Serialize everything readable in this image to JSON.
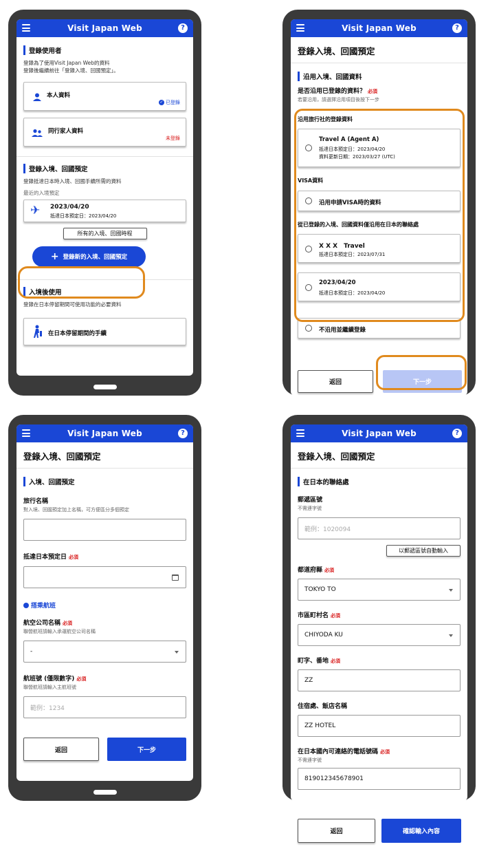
{
  "app": {
    "title": "Visit Japan Web",
    "help": "?"
  },
  "p1": {
    "sec1_title": "登錄使用者",
    "sec1_desc1": "登錄為了使用Visit Japan Web的資料",
    "sec1_desc2": "登錄後繼續前往「登錄入境、回國預定」。",
    "card_self": "本人資料",
    "card_self_status": "已登錄",
    "card_family": "同行家人資料",
    "card_family_status": "未登錄",
    "sec2_title": "登錄入境、回國預定",
    "sec2_desc": "登錄抵達日本時入境、回國手續所需的資料",
    "recent_label": "最近的入境預定",
    "trip_date": "2023/04/20",
    "trip_sub": "抵達日本預定日：2023/04/20",
    "all_trips": "所有的入境、回國時程",
    "new_trip_btn": "登錄新的入境、回國預定",
    "sec3_title": "入境後使用",
    "sec3_desc": "登錄在日本停留期間可使用功能的必要資料",
    "stay_card": "在日本停留期間的手續"
  },
  "p2": {
    "page_title": "登錄入境、回國預定",
    "sec_title": "沿用入境、回國資料",
    "question": "是否沿用已登錄的資料？",
    "required": "必須",
    "question_hint": "若要沿用，請選擇沿用項目後按下一步",
    "agent_head": "沿用旅行社的登錄資料",
    "agent_name": "Travel A (Agent A)",
    "agent_line1": "抵達日本預定日：2023/04/20",
    "agent_line2": "資料更新日期：2023/03/27 (UTC)",
    "visa_head": "VISA資料",
    "visa_option": "沿用申請VISA時的資料",
    "prev_head": "從已登錄的入境、回國資料僅沿用在日本的聯絡處",
    "prev1_name": "X X X　Travel",
    "prev1_sub": "抵達日本預定日：2023/07/31",
    "prev2_name": "2023/04/20",
    "prev2_sub": "抵達日本預定日：2023/04/20",
    "no_reuse": "不沿用並繼續登錄",
    "back": "返回",
    "next": "下一步"
  },
  "p3": {
    "page_title": "登錄入境、回國預定",
    "sec_title": "入境、回國預定",
    "trip_name_label": "旅行名稱",
    "trip_name_hint": "對入境、回國預定加上名稱，可方便區分多個預定",
    "arrival_label": "抵達日本預定日",
    "required": "必須",
    "flight_head": "搭乘航班",
    "airline_label": "航空公司名稱",
    "airline_hint": "聯營航班請輸入承運航空公司名稱",
    "airline_value": "-",
    "flight_no_label": "航班號 (僅限數字)",
    "flight_no_hint": "聯營航班請輸入主航班號",
    "flight_no_placeholder": "範例：1234",
    "back": "返回",
    "next": "下一步"
  },
  "p4": {
    "page_title": "登錄入境、回國預定",
    "sec_title": "在日本的聯絡處",
    "postal_label": "郵遞區號",
    "postal_hint": "不需連字號",
    "postal_placeholder": "範例：1020094",
    "auto_fill": "以郵遞區號自動輸入",
    "pref_label": "都道府縣",
    "pref_value": "TOKYO TO",
    "city_label": "市區町村名",
    "city_value": "CHIYODA KU",
    "addr_label": "町字、番地",
    "addr_value": "ZZ",
    "hotel_label": "住宿處、飯店名稱",
    "hotel_value": "ZZ HOTEL",
    "phone_label": "在日本國內可連絡的電話號碼",
    "phone_hint": "不需連字號",
    "phone_value": "819012345678901",
    "required": "必須",
    "back": "返回",
    "confirm": "確認輸入內容"
  },
  "colors": {
    "brand": "#1a47d6",
    "highlight": "#e08a1e",
    "required": "#d81b1b",
    "disabled": "#b8c6f5"
  }
}
